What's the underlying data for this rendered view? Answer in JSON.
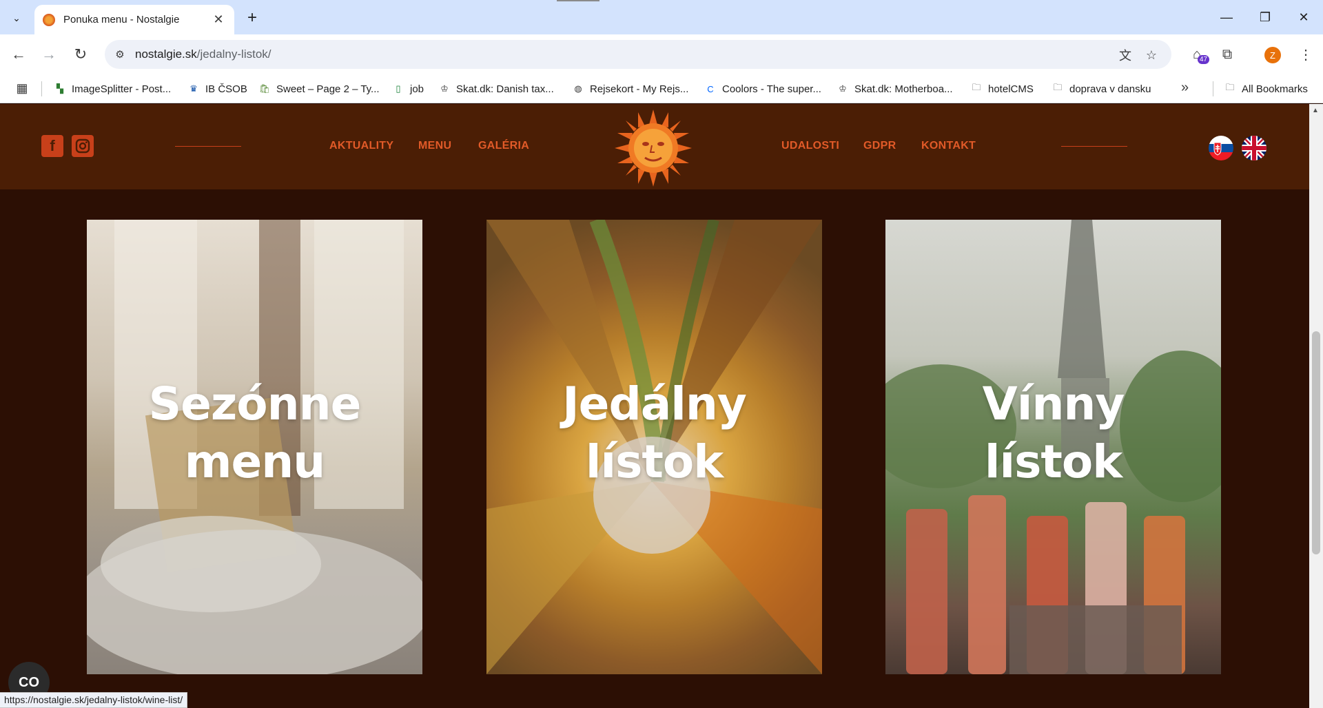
{
  "browser": {
    "tab": {
      "title": "Ponuka menu - Nostalgie"
    },
    "url": {
      "host": "nostalgie.sk",
      "path": "/jedalny-listok/"
    },
    "extension_badge": "47",
    "profile_initial": "Z",
    "bookmarks": [
      {
        "label": "ImageSplitter - Post...",
        "icon": "imagesplitter-icon"
      },
      {
        "label": "IB ČSOB",
        "icon": "csob-icon"
      },
      {
        "label": "Sweet – Page 2 – Ty...",
        "icon": "shopify-icon"
      },
      {
        "label": "job",
        "icon": "sheet-icon"
      },
      {
        "label": "Skat.dk: Danish tax...",
        "icon": "crown-icon"
      },
      {
        "label": "Rejsekort - My Rejs...",
        "icon": "globe-icon"
      },
      {
        "label": "Coolors - The super...",
        "icon": "coolors-icon"
      },
      {
        "label": "Skat.dk: Motherboa...",
        "icon": "crown-icon"
      },
      {
        "label": "hotelCMS",
        "icon": "folder-icon"
      },
      {
        "label": "doprava v dansku",
        "icon": "folder-icon"
      }
    ],
    "all_bookmarks_label": "All Bookmarks",
    "status_url": "https://nostalgie.sk/jedalny-listok/wine-list/"
  },
  "site": {
    "nav_left": [
      "AKTUALITY",
      "MENU",
      "GALÉRIA"
    ],
    "nav_right": [
      "UDALOSTI",
      "GDPR",
      "KONTAKT"
    ],
    "cards": [
      {
        "title": "Sezónne\nmenu"
      },
      {
        "title": "Jedálny\nlístok"
      },
      {
        "title": "Vínny\nlístok"
      }
    ],
    "cookie_label": "CO"
  },
  "colors": {
    "header_bg": "#4b1e05",
    "page_bg": "#2c0f04",
    "accent": "#e15a28"
  }
}
